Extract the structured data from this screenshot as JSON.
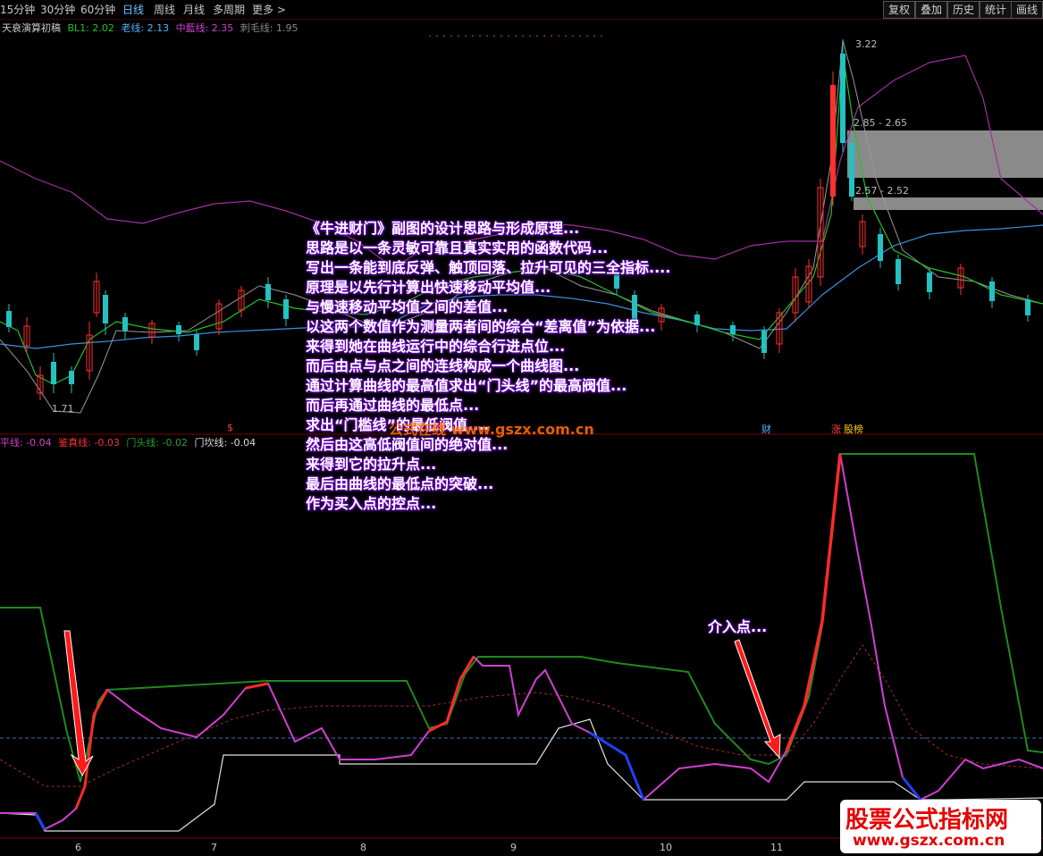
{
  "toolbar": {
    "periods": [
      "15分钟",
      "30分钟",
      "60分钟",
      "日线",
      "周线",
      "月线",
      "多周期",
      "更多 >"
    ],
    "active_period": "日线",
    "buttons": [
      "复权",
      "叠加",
      "历史",
      "统计",
      "画线"
    ]
  },
  "main_legend": {
    "title": "天衰演算初稿",
    "items": [
      {
        "label": "BL1: 2.02",
        "color": "#22c222"
      },
      {
        "label": "老线: 2.13",
        "color": "#4fb3ff"
      },
      {
        "label": "中藍线: 2.35",
        "color": "#d040d0"
      },
      {
        "label": "刺毛线: 1.95",
        "color": "#888888"
      }
    ]
  },
  "price_labels": {
    "high": "3.22",
    "zone1": "2.85 - 2.65",
    "zone2": "2.57 - 2.52",
    "low": "1.71"
  },
  "sub_legend": {
    "items": [
      {
        "label": "平线: -0.04",
        "color": "#d040d0"
      },
      {
        "label": "鉴真线: -0.03",
        "color": "#ff3030"
      },
      {
        "label": "门头线: -0.02",
        "color": "#2aa02a"
      },
      {
        "label": "门坎线: -0.04",
        "color": "#dddddd"
      }
    ]
  },
  "event_marks": [
    "$",
    "财",
    "涨",
    "股榜"
  ],
  "annotation": [
    "《牛进财门》副图的设计思路与形成原理...",
    "思路是以一条灵敏可靠且真实实用的函数代码...",
    "写出一条能到底反弹、触顶回落、拉升可见的三全指标....",
    "原理是以先行计算出快速移动平均值...",
    "与慢速移动平均值之间的差值...",
    "以这两个数值作为测量两者间的综合“差离值”为依据...",
    "来得到她在曲线运行中的综合行进点位...",
    "而后由点与点之间的连线构成一个曲线图...",
    "通过计算曲线的最高值求出“门头线”的最高阀值...",
    "而后再通过曲线的最低点...",
    "求出“门槛线”的最低阀值....",
    "然后由这高低阀值间的绝对值...",
    "来得到它的拉升点...",
    "最后由曲线的最低点的突破...",
    "作为买入点的控点..."
  ],
  "entry_label": "介入点...",
  "x_axis": [
    "6",
    "7",
    "8",
    "9",
    "10",
    "11"
  ],
  "watermark_mid": "公式在线 www.gszx.com.cn",
  "watermark_logo": {
    "title": "股票公式指标网",
    "url": "www.gszx.com.cn"
  }
}
